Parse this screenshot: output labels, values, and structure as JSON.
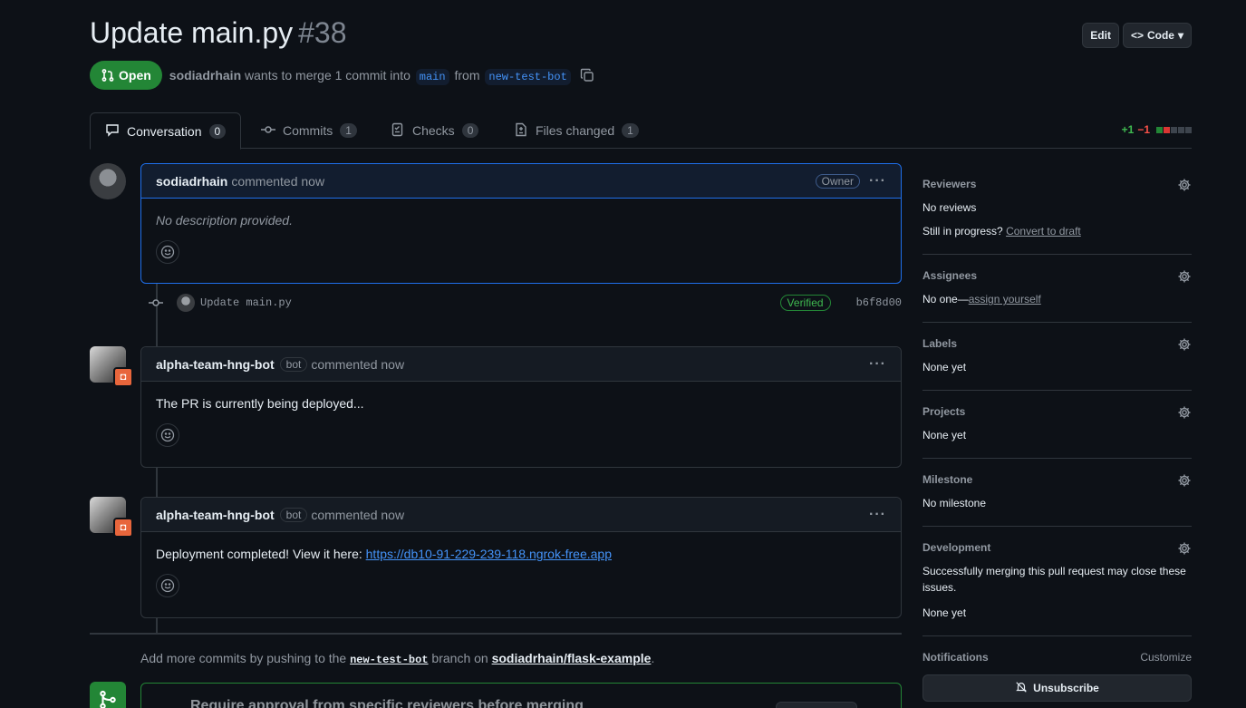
{
  "header": {
    "title": "Update main.py",
    "number": "#38",
    "edit_label": "Edit",
    "code_label": "Code"
  },
  "state": {
    "badge": "Open",
    "author": "sodiadrhain",
    "text_mid": "wants to merge 1 commit into",
    "base_branch": "main",
    "text_from": "from",
    "head_branch": "new-test-bot"
  },
  "tabs": [
    {
      "label": "Conversation",
      "count": "0"
    },
    {
      "label": "Commits",
      "count": "1"
    },
    {
      "label": "Checks",
      "count": "0"
    },
    {
      "label": "Files changed",
      "count": "1"
    }
  ],
  "diffstat": {
    "additions": "+1",
    "deletions": "−1"
  },
  "timeline": {
    "comment1": {
      "author": "sodiadrhain",
      "time": "commented now",
      "role": "Owner",
      "body": "No description provided."
    },
    "commit": {
      "message": "Update main.py",
      "verified": "Verified",
      "sha": "b6f8d00"
    },
    "comment2": {
      "author": "alpha-team-hng-bot",
      "bot_label": "bot",
      "time": "commented now",
      "body": "The PR is currently being deployed..."
    },
    "comment3": {
      "author": "alpha-team-hng-bot",
      "bot_label": "bot",
      "time": "commented now",
      "body_prefix": "Deployment completed! View it here: ",
      "link": "https://db10-91-229-239-118.ngrok-free.app"
    }
  },
  "push_note": {
    "prefix": "Add more commits by pushing to the ",
    "branch": "new-test-bot",
    "mid": " branch on ",
    "repo": "sodiadrhain/flask-example",
    "suffix": "."
  },
  "merge_box": {
    "text": "Require approval from specific reviewers before merging"
  },
  "sidebar": {
    "reviewers": {
      "title": "Reviewers",
      "value": "No reviews",
      "draft_prefix": "Still in progress?",
      "draft_link": "Convert to draft"
    },
    "assignees": {
      "title": "Assignees",
      "value_prefix": "No one—",
      "value_link": "assign yourself"
    },
    "labels": {
      "title": "Labels",
      "value": "None yet"
    },
    "projects": {
      "title": "Projects",
      "value": "None yet"
    },
    "milestone": {
      "title": "Milestone",
      "value": "No milestone"
    },
    "development": {
      "title": "Development",
      "description": "Successfully merging this pull request may close these issues.",
      "value": "None yet"
    },
    "notifications": {
      "title": "Notifications",
      "customize": "Customize",
      "unsubscribe": "Unsubscribe"
    }
  },
  "colors": {
    "open_green": "#238636",
    "accent_blue": "#4493f8",
    "bg": "#0d1117"
  }
}
